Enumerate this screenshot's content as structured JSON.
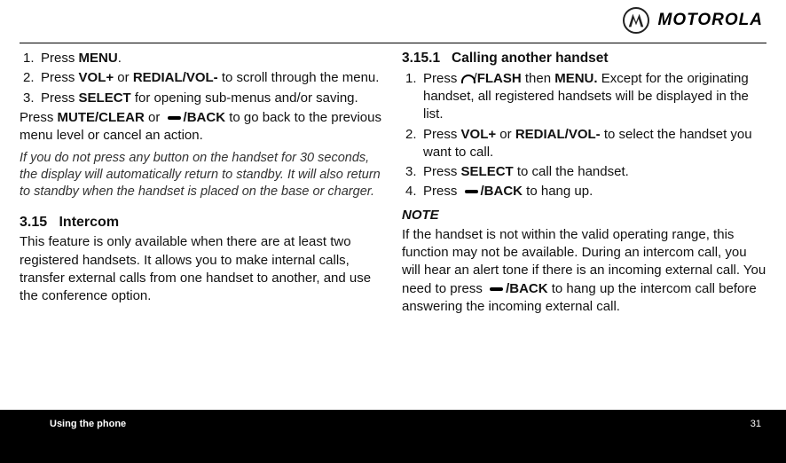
{
  "brand": "MOTOROLA",
  "left": {
    "items": [
      {
        "num": "1.",
        "pre": "Press ",
        "bold": "MENU",
        "post": "."
      },
      {
        "num": "2.",
        "pre": "Press ",
        "bold": "VOL+",
        "mid": " or ",
        "bold2": "REDIAL/VOL-",
        "post": " to scroll through the menu."
      },
      {
        "num": "3.",
        "pre": "Press ",
        "bold": "SELECT",
        "post": " for opening sub-menus and/or saving."
      }
    ],
    "para1_pre": "Press ",
    "para1_b1": "MUTE/CLEAR",
    "para1_mid": " or  ",
    "para1_b2": "/BACK",
    "para1_post": " to go back to the previous menu level or cancel an action.",
    "italic": "If you do not press any button on the handset for 30 seconds, the display will automatically return to standby. It will also return to standby when the handset is placed on the base or charger.",
    "sec_num": "3.15",
    "sec_title": "Intercom",
    "sec_body": "This feature is only available when there are at least two registered handsets. It allows you to make internal calls, transfer external calls from one handset to another, and use the conference option."
  },
  "right": {
    "sub_num": "3.15.1",
    "sub_title": "Calling another handset",
    "items": [
      {
        "num": "1.",
        "pre": "Press ",
        "iconDial": true,
        "slash": "/",
        "bold": "FLASH",
        "mid": " then ",
        "bold2": "MENU.",
        "post": " Except for the originating handset, all registered handsets will be displayed in the list."
      },
      {
        "num": "2.",
        "pre": "Press ",
        "bold": "VOL+",
        "mid": " or ",
        "bold2": "REDIAL/VOL-",
        "post": " to select the handset you want to call."
      },
      {
        "num": "3.",
        "pre": "Press ",
        "bold": "SELECT",
        "post": " to call the handset."
      },
      {
        "num": "4.",
        "pre": "Press ",
        "iconBack": true,
        "bold": "/BACK",
        "post": " to hang up."
      }
    ],
    "note_h": "NOTE",
    "note_pre": "If the handset is not within the valid operating range, this function may not be available. During an intercom call, you will hear an alert tone if there is an incoming external call. You need to press ",
    "note_bold": "/BACK",
    "note_post": " to hang up the intercom call before answering the incoming external call."
  },
  "footer": {
    "title": "Using the phone",
    "page": "31"
  }
}
